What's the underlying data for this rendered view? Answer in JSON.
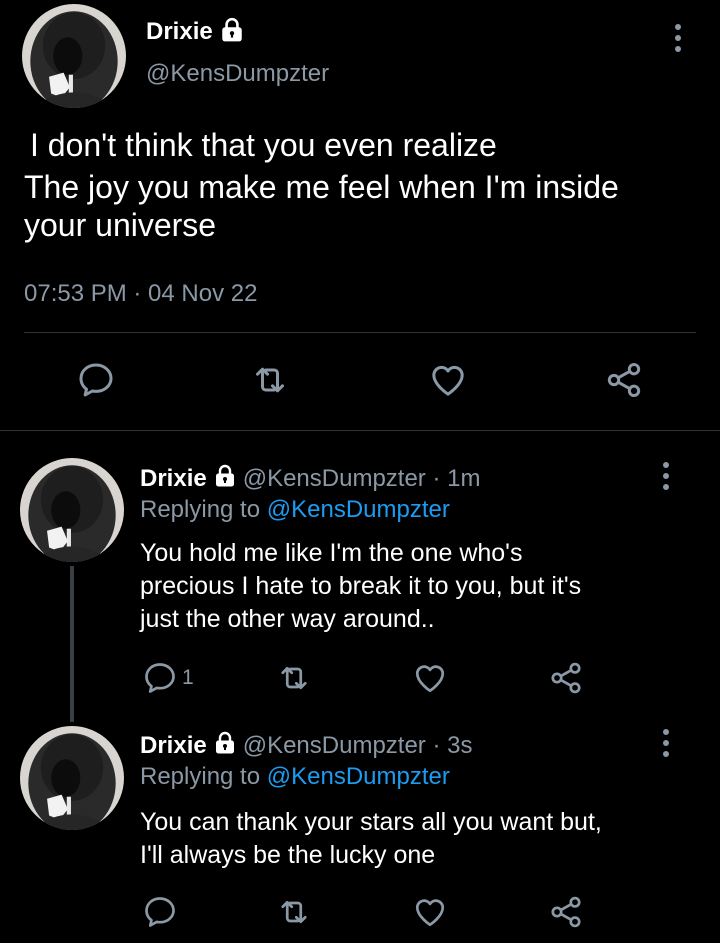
{
  "main_tweet": {
    "display_name": "Drixie",
    "handle": "@KensDumpzter",
    "text_lines": [
      "I don't think that you even realize",
      "The joy you make me feel when I'm inside",
      "your universe"
    ],
    "timestamp": "07:53 PM · 04 Nov 22"
  },
  "replies": [
    {
      "display_name": "Drixie",
      "handle_time": "@KensDumpzter · 1m",
      "replying_prefix": "Replying to ",
      "replying_to": "@KensDumpzter",
      "text_lines": [
        "You hold me like I'm the one who's",
        "precious I hate to break it to you, but it's",
        "just the other way around.."
      ],
      "reply_count": "1"
    },
    {
      "display_name": "Drixie",
      "handle_time": "@KensDumpzter · 3s",
      "replying_prefix": "Replying to ",
      "replying_to": "@KensDumpzter",
      "text_lines": [
        "You can thank your stars all you want but,",
        "I'll always be the lucky one"
      ],
      "reply_count": ""
    }
  ],
  "icons": {
    "lock": "lock-icon",
    "more": "more-vertical-icon",
    "reply": "reply-icon",
    "retweet": "retweet-icon",
    "like": "heart-icon",
    "share": "share-icon"
  },
  "colors": {
    "background": "#000000",
    "text": "#ffffff",
    "muted": "#8b98a5",
    "link": "#1d9bf0",
    "divider": "#2f3336"
  }
}
